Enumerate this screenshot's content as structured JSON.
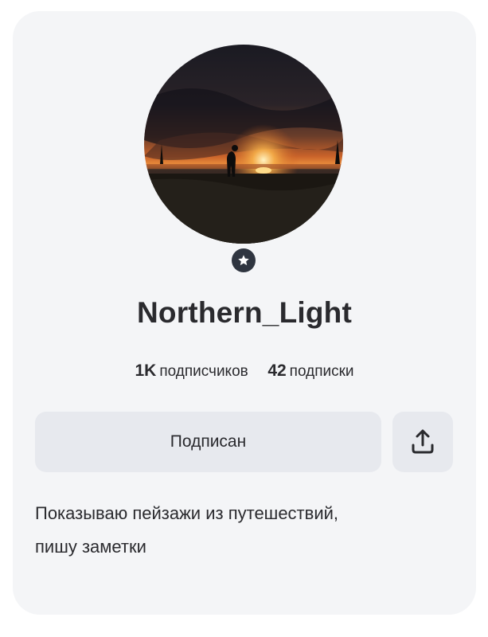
{
  "profile": {
    "username": "Northern_Light",
    "avatar_alt": "sunset-landscape-photo",
    "badge_icon": "star-badge-icon",
    "stats": {
      "followers_count": "1K",
      "followers_label": "подписчиков",
      "following_count": "42",
      "following_label": "подписки"
    },
    "subscribe_label": "Подписан",
    "share_icon": "share-icon",
    "bio_line1": "Показываю пейзажи из путешествий,",
    "bio_line2": "пишу заметки"
  },
  "colors": {
    "card_bg": "#f4f5f7",
    "button_bg": "#e7e9ee",
    "badge_bg": "#2f3540",
    "text": "#2a2a2e"
  }
}
